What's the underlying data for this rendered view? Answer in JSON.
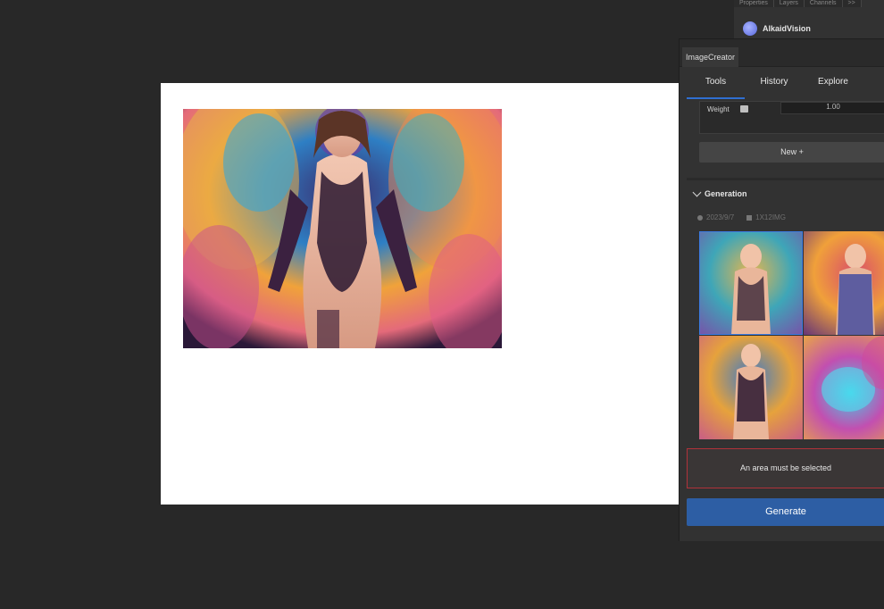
{
  "background_panel": {
    "tabs": [
      "Properties",
      "Layers",
      "Channels"
    ],
    "extra_tab": ">>",
    "plugin_name": "AlkaidVision"
  },
  "panel": {
    "tab_title": "ImageCreator",
    "subtabs": [
      "Tools",
      "History",
      "Explore"
    ],
    "active_subtab": "Tools",
    "weight_label": "Weight",
    "weight_value": "1.00",
    "new_button": "New +",
    "generation_title": "Generation",
    "generation_date": "2023/9/7",
    "generation_count": "1X12IMG",
    "warning_text": "An area must be selected",
    "generate_button": "Generate",
    "colors": {
      "accent": "#2d5ea4",
      "warning_border": "#b0323a",
      "selected_outline": "#3c7be0"
    }
  }
}
